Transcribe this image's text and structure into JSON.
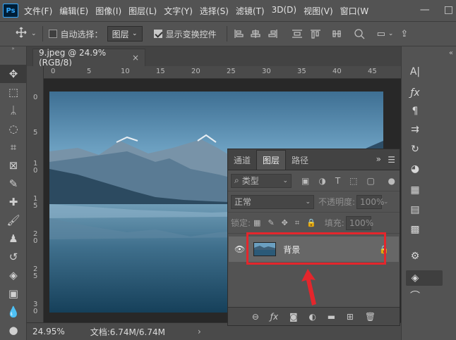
{
  "app": {
    "logo": "Ps"
  },
  "menu": [
    "文件(F)",
    "编辑(E)",
    "图像(I)",
    "图层(L)",
    "文字(Y)",
    "选择(S)",
    "滤镜(T)",
    "3D(D)",
    "视图(V)",
    "窗口(W"
  ],
  "window_controls": {
    "minimize": "—",
    "maximize": "□"
  },
  "options": {
    "auto_select_label": "自动选择：",
    "auto_select_value": "图层",
    "show_transform_label": "显示变换控件"
  },
  "document_tab": {
    "title": "9.jpeg @ 24.9%(RGB/8)",
    "close": "×"
  },
  "rulers": {
    "top": [
      "0",
      "5",
      "10",
      "15",
      "20",
      "25",
      "30",
      "35",
      "40",
      "45"
    ],
    "left": [
      "0",
      "5",
      "1\n0",
      "1\n5",
      "2\n0",
      "2\n5",
      "3\n0"
    ]
  },
  "status": {
    "zoom": "24.95%",
    "doc": "文档:6.74M/6.74M",
    "arrow": "›"
  },
  "layers_panel": {
    "tabs": [
      "通道",
      "图层",
      "路径"
    ],
    "active_tab": "图层",
    "filter_label": "类型",
    "blend_mode": "正常",
    "opacity_label": "不透明度:",
    "opacity_value": "100%",
    "lock_label": "锁定:",
    "fill_label": "填充:",
    "fill_value": "100%",
    "layer_name": "背景",
    "bottom_icons": [
      "link-icon",
      "fx-icon",
      "mask-icon",
      "adjustment-icon",
      "folder-icon",
      "new-layer-icon",
      "trash-icon"
    ]
  },
  "colors": {
    "highlight": "#e4262c",
    "accent": "#31a8ff"
  }
}
